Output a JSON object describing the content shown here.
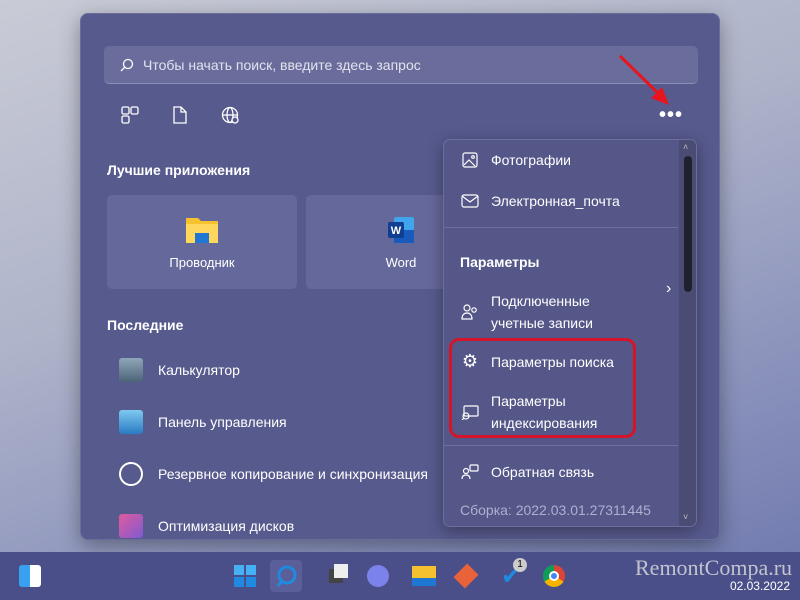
{
  "search": {
    "placeholder": "Чтобы начать поиск, введите здесь запрос"
  },
  "filters": [
    {
      "icon": "apps-icon"
    },
    {
      "icon": "document-icon"
    },
    {
      "icon": "web-icon"
    }
  ],
  "more_button": "•••",
  "top_apps": {
    "title": "Лучшие приложения",
    "items": [
      {
        "label": "Проводник",
        "icon": "file-explorer-icon"
      },
      {
        "label": "Word",
        "icon": "word-icon"
      }
    ]
  },
  "recent": {
    "title": "Последние",
    "items": [
      {
        "label": "Калькулятор"
      },
      {
        "label": "Панель управления"
      },
      {
        "label": "Резервное копирование и синхронизация"
      },
      {
        "label": "Оптимизация дисков"
      }
    ]
  },
  "menu": {
    "photos": "Фотографии",
    "email": "Электронная_почта",
    "section": "Параметры",
    "accounts_1": "Подключенные",
    "accounts_2": "учетные записи",
    "search_settings": "Параметры поиска",
    "indexing_1": "Параметры",
    "indexing_2": "индексирования",
    "feedback": "Обратная связь",
    "build": "Сборка: 2022.03.01.27311445"
  },
  "taskbar": {
    "badge": "1",
    "date": "02.03.2022"
  },
  "watermark": "RemontCompa.ru",
  "colors": {
    "highlight": "#d5142a",
    "arrow": "#e8141e"
  }
}
